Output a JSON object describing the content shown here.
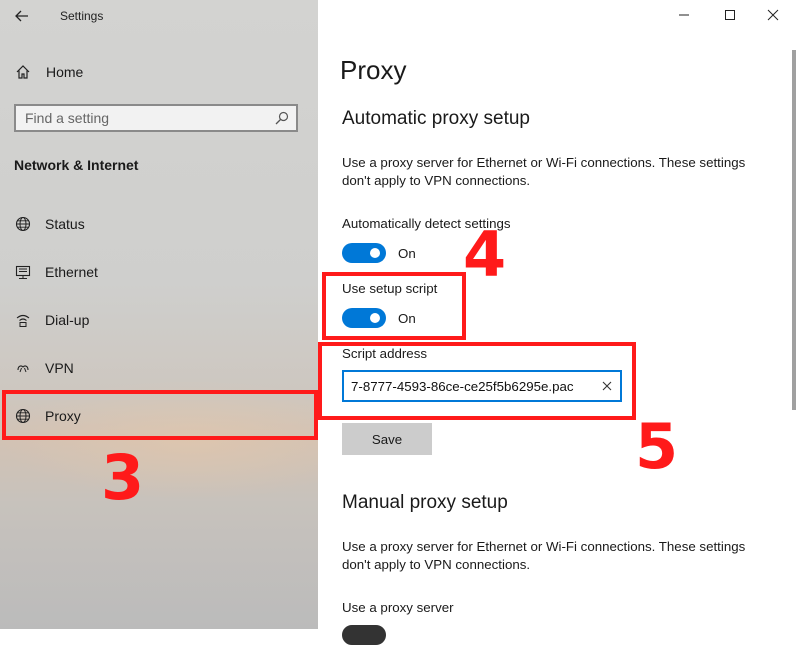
{
  "window": {
    "app_title": "Settings"
  },
  "sidebar": {
    "home_label": "Home",
    "search_placeholder": "Find a setting",
    "section_heading": "Network & Internet",
    "items": [
      {
        "label": "Status",
        "icon": "globe-status-icon"
      },
      {
        "label": "Ethernet",
        "icon": "ethernet-icon"
      },
      {
        "label": "Dial-up",
        "icon": "dialup-icon"
      },
      {
        "label": "VPN",
        "icon": "vpn-icon"
      },
      {
        "label": "Proxy",
        "icon": "globe-icon"
      }
    ]
  },
  "main": {
    "page_title": "Proxy",
    "auto": {
      "heading": "Automatic proxy setup",
      "description": "Use a proxy server for Ethernet or Wi-Fi connections. These settings don't apply to VPN connections.",
      "detect_label": "Automatically detect settings",
      "detect_state": "On",
      "script_label": "Use setup script",
      "script_state": "On",
      "address_label": "Script address",
      "address_value": "7-8777-4593-86ce-ce25f5b6295e.pac",
      "save_label": "Save"
    },
    "manual": {
      "heading": "Manual proxy setup",
      "description": "Use a proxy server for Ethernet or Wi-Fi connections. These settings don't apply to VPN connections.",
      "use_proxy_label": "Use a proxy server"
    }
  },
  "annotations": {
    "step3": "3",
    "step4": "4",
    "step5": "5"
  },
  "colors": {
    "accent": "#0078d7",
    "annotation_red": "#ff1a1a"
  }
}
